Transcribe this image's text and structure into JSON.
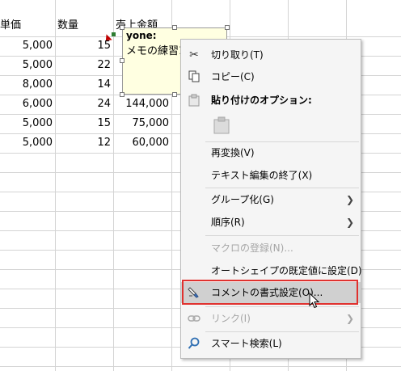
{
  "sheet": {
    "headers": [
      "単価",
      "数量",
      "売上金額"
    ],
    "rows": [
      {
        "price": "5,000",
        "qty": "15",
        "sales": ""
      },
      {
        "price": "5,000",
        "qty": "22",
        "sales": ""
      },
      {
        "price": "8,000",
        "qty": "14",
        "sales": ""
      },
      {
        "price": "6,000",
        "qty": "24",
        "sales": "144,000"
      },
      {
        "price": "5,000",
        "qty": "15",
        "sales": "75,000"
      },
      {
        "price": "5,000",
        "qty": "12",
        "sales": "60,000"
      }
    ]
  },
  "comment": {
    "author": "yone:",
    "text": "メモの練習1"
  },
  "menu": {
    "cut": "切り取り(T)",
    "copy": "コピー(C)",
    "paste_options": "貼り付けのオプション:",
    "reconvert": "再変換(V)",
    "exit_text_edit": "テキスト編集の終了(X)",
    "group": "グループ化(G)",
    "order": "順序(R)",
    "assign_macro": "マクロの登録(N)...",
    "set_default_shape": "オートシェイプの既定値に設定(D)",
    "format_comment": "コメントの書式設定(O)...",
    "link": "リンク(I)",
    "smart_lookup": "スマート検索(L)"
  },
  "icons": {
    "cut": "scissors-icon",
    "copy": "copy-icon",
    "paste": "clipboard-icon",
    "format_comment": "paint-format-icon",
    "link": "link-icon",
    "smart_lookup": "search-icon",
    "submenu": "chevron-right-icon"
  },
  "colors": {
    "highlight_border": "#e0312e",
    "comment_bg": "#ffffe1",
    "menu_bg": "#f5f5f5"
  }
}
